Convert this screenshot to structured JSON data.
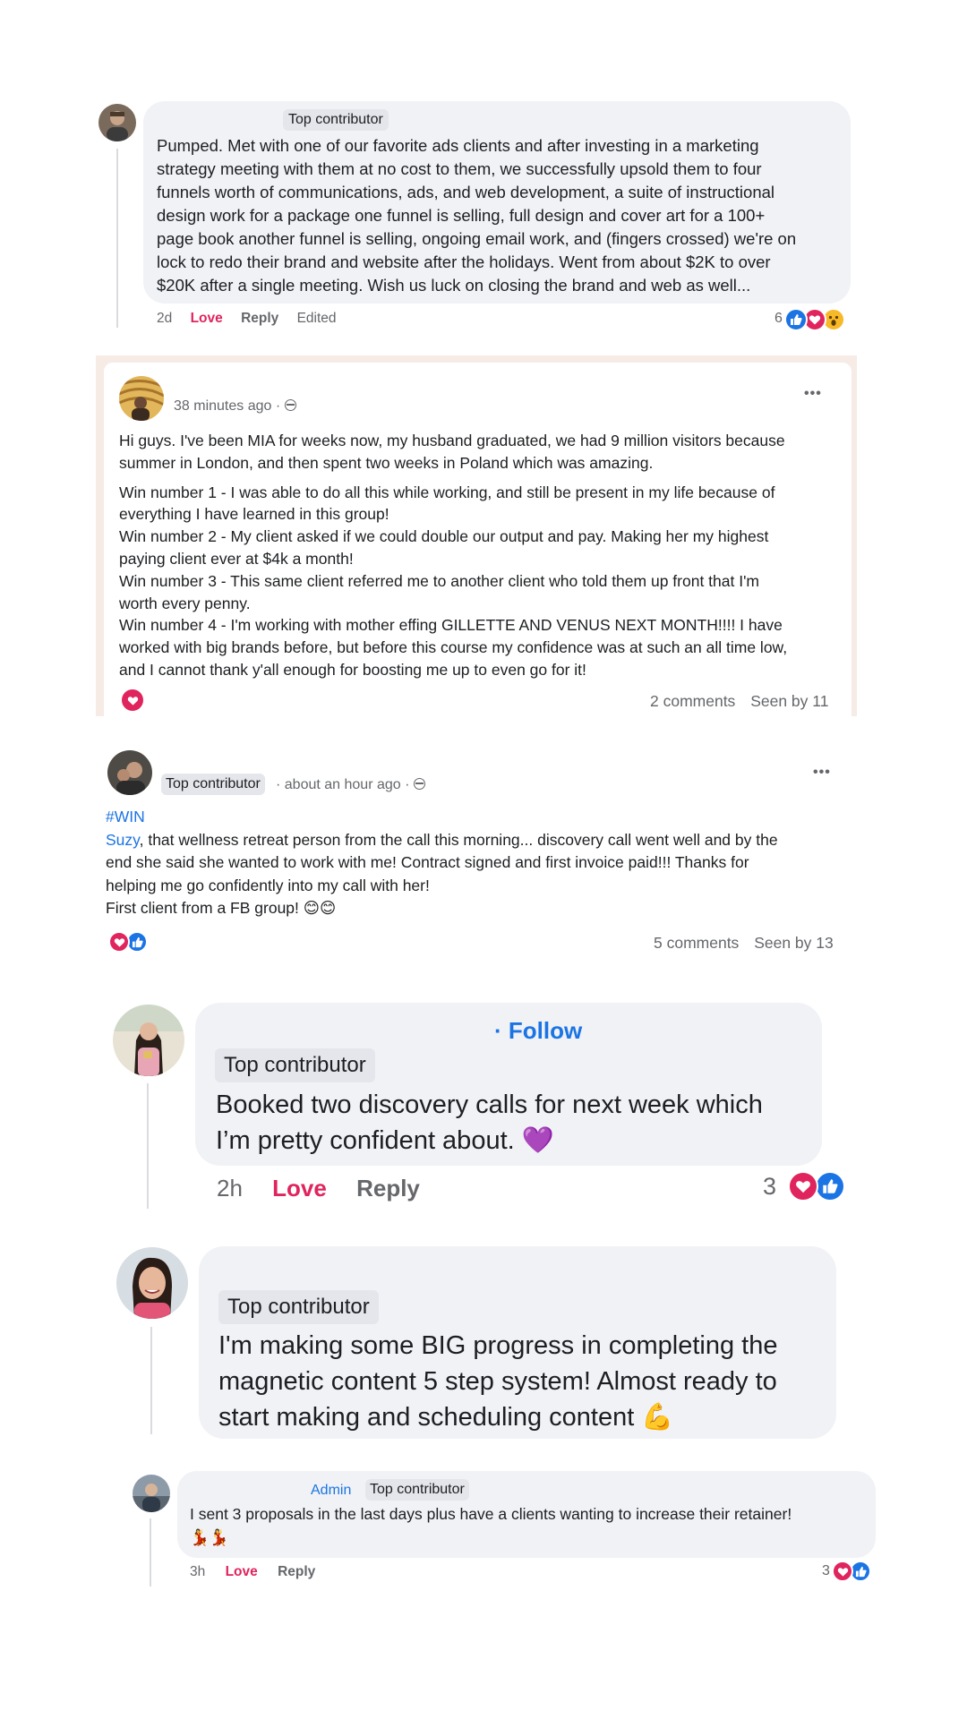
{
  "post1": {
    "badge": "Top contributor",
    "lines": [
      "Pumped. Met with one of our favorite ads clients and after investing in a marketing",
      "strategy meeting with them at no cost to them, we successfully upsold them to four",
      "funnels worth of communications, ads, and web development, a suite of instructional",
      "design work for a package one funnel is selling, full design and cover art for a 100+",
      "page book another funnel is selling, ongoing email work, and (fingers crossed) we're on",
      "lock to redo their brand and website after the holidays. Went from about $2K to over",
      "$20K after a single meeting. Wish us luck on closing the brand and web as well..."
    ],
    "time": "2d",
    "love": "Love",
    "reply": "Reply",
    "edited": "Edited",
    "reaction_count": "6",
    "reactions": [
      "like-icon",
      "love-icon",
      "wow-icon"
    ]
  },
  "post2": {
    "meta": "38 minutes ago ·",
    "paragraphs": [
      [
        "Hi guys. I've been MIA for weeks now, my husband graduated, we had 9 million visitors because",
        "summer in London, and then spent two weeks in Poland which was amazing."
      ],
      [
        "Win number 1 - I was able to do all this while working, and still be present in my life because of",
        "everything I have learned in this group!",
        "Win number 2 - My client asked if we could double our output and pay. Making her my highest",
        "paying client ever at $4k a month!",
        "Win number 3 - This same client referred me to another client who told them up front that I'm",
        "worth every penny.",
        "Win number 4 - I'm working with mother effing GILLETTE AND VENUS NEXT MONTH!!!! I have",
        "worked with big brands before, but before this course my confidence was at such an all time low,",
        "and I cannot thank y'all enough for boosting me up to even go for it!"
      ]
    ],
    "comments": "2 comments",
    "seen": "Seen by 11",
    "more": "•••"
  },
  "post3": {
    "badge": "Top contributor",
    "meta": "· about an hour ago ·",
    "hashtag": "#WIN",
    "mention": "Suzy",
    "lines": [
      ", that wellness retreat person from the call this morning... discovery call went well and by the",
      "end she said she wanted to work with me! Contract signed and first invoice paid!!! Thanks for",
      "helping me go confidently into my call with her!",
      "First client from a FB group! 😊😊"
    ],
    "comments": "5 comments",
    "seen": "Seen by 13",
    "more": "•••"
  },
  "comment1": {
    "follow": "· Follow",
    "badge": "Top contributor",
    "lines": [
      "Booked two discovery calls for next week which",
      "I’m pretty confident about. 💜"
    ],
    "time": "2h",
    "love": "Love",
    "reply": "Reply",
    "reaction_count": "3"
  },
  "comment2": {
    "badge": "Top contributor",
    "lines": [
      "I'm making some BIG progress in completing the",
      "magnetic content 5 step system! Almost ready to",
      "start making and scheduling content 💪"
    ]
  },
  "comment3": {
    "admin": "Admin",
    "badge": "Top contributor",
    "lines": [
      "I sent 3 proposals in the last days plus have a clients wanting to increase their retainer!",
      "💃💃"
    ],
    "time": "3h",
    "love": "Love",
    "reply": "Reply",
    "reaction_count": "3"
  },
  "colors": {
    "love": "#e0245e",
    "like": "#1b74e4",
    "bubble": "#f0f2f5",
    "muted": "#65676b"
  }
}
